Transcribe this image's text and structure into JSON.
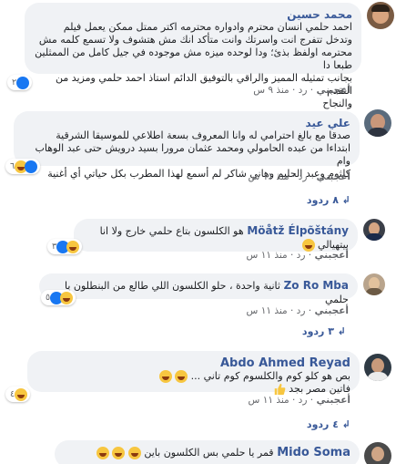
{
  "comments": [
    {
      "author": "محمد حسين",
      "lines": [
        "احمد حلمي انسان محترم وادواره محترمه اكتر ممتل ممكن يعمل فيلم",
        "وتدخل تتفرج انت واسرتك وانت متأكد انك مش هتشوف ولا تسمع كلمه مش",
        "محترمه اولفظ بذئ؛ ودا لوحده ميزه مش موجوده في جيل كامل من الممثلين طبعا دا",
        "بجانب تمثيله المميز والراقي بالتوفيق الدائم استاذ احمد حلمي ومزيد من التقدم",
        "والنجاح"
      ],
      "reaction_count": "٢",
      "actions": {
        "like": "أعجبني",
        "reply": "رد",
        "time": "منذ ٩ س"
      }
    },
    {
      "author": "علي عيد",
      "lines": [
        "صدقا مع بالغ احترامي له وانا المعروف بسعة اطلاعي للموسيقا الشرقية",
        "ابتداءا من عبده الحامولي ومحمد عثمان مرورا بسيد درويش حتى عبد الوهاب وام",
        "كلثوم وعبد الحليم وهاني شاكر لم أسمع لهذا المطرب بكل حياتي أي أغنية"
      ],
      "reaction_count": "٦",
      "actions": {
        "like": "أعجبني",
        "reply": "رد",
        "time": "منذ ١١ س"
      },
      "replies_label": "٨ ردود"
    },
    {
      "author": "Möåtž Élpõštány",
      "lines": [
        "هو الكلسون بتاع حلمي خارج ولا انا بيتهيالي"
      ],
      "reaction_count": "٣",
      "actions": {
        "like": "أعجبني",
        "reply": "رد",
        "time": "منذ ١١ س"
      }
    },
    {
      "author": "Zo Ro Mba",
      "lines": [
        "ثانية واحدة ، حلو الكلسون اللي طالع من البنطلون يا حلمي"
      ],
      "reaction_count": "٥",
      "actions": {
        "like": "أعجبني",
        "reply": "رد",
        "time": "منذ ١١ س"
      },
      "replies_label": "٣ ردود"
    },
    {
      "author": "Abdo Ahmed Reyad",
      "lines": [
        "بص هو كلو كوم والكلسوم كوم تاني ...",
        "فاتين مصر بجد"
      ],
      "reaction_count": "٤",
      "actions": {
        "like": "أعجبني",
        "reply": "رد",
        "time": "منذ ١١ س"
      },
      "replies_label": "٤ ردود"
    },
    {
      "author": "Mido Soma",
      "lines": [
        "قمر يا حلمي بس الكلسون باين"
      ],
      "reaction_count": ""
    }
  ],
  "colors": {
    "link": "#385898",
    "bubble": "#f0f2f5",
    "muted": "#65676b",
    "like": "#1877f2",
    "haha": "#f7c640"
  }
}
